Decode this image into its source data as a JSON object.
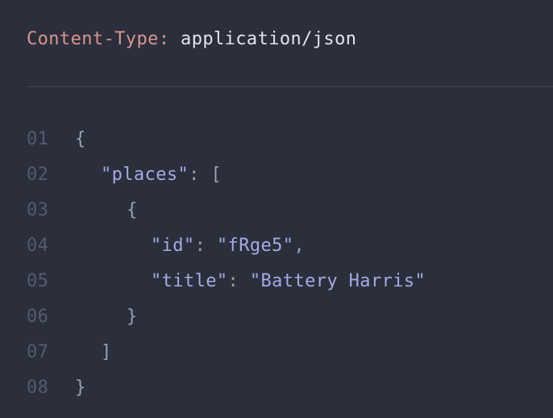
{
  "header": {
    "name": "Content-Type:",
    "value": "application/json"
  },
  "code": {
    "line_numbers": [
      "01",
      "02",
      "03",
      "04",
      "05",
      "06",
      "07",
      "08"
    ],
    "open_brace": "{",
    "places_key": "\"places\"",
    "colon": ":",
    "open_bracket": "[",
    "item_open": "{",
    "id_key": "\"id\"",
    "id_value": "\"fRge5\"",
    "comma": ",",
    "title_key": "\"title\"",
    "title_value": "\"Battery Harris\"",
    "item_close": "}",
    "close_bracket": "]",
    "close_brace": "}"
  }
}
